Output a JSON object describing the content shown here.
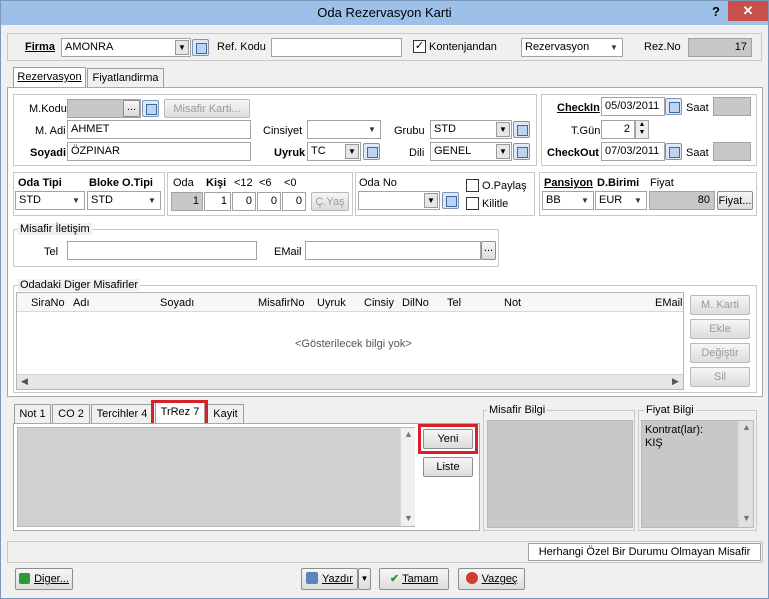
{
  "window": {
    "title": "Oda Rezervasyon Karti",
    "help": "?",
    "close": "✕"
  },
  "header": {
    "firma_label": "Firma",
    "firma_value": "AMONRA",
    "refkodu_label": "Ref. Kodu",
    "refkodu_value": "",
    "kontenjan_label": "Kontenjandan",
    "kontenjan_checked": "✓",
    "type_value": "Rezervasyon",
    "rezno_label": "Rez.No",
    "rezno_value": "17"
  },
  "tabs": [
    {
      "label": "Rezervasyon"
    },
    {
      "label": "Fiyatlandirma"
    }
  ],
  "guest": {
    "mkodu_label": "M.Kodu",
    "dots": "...",
    "misafir_karti": "Misafir Karti...",
    "madi_label": "M. Adi",
    "madi_value": "AHMET",
    "soyadi_label": "Soyadi",
    "soyadi_value": "ÖZPINAR",
    "cinsiyet_label": "Cinsiyet",
    "cinsiyet_value": "",
    "uyruk_label": "Uyruk",
    "uyruk_value": "TC",
    "grubu_label": "Grubu",
    "grubu_value": "STD",
    "dili_label": "Dili",
    "dili_value": "GENEL"
  },
  "dates": {
    "checkin_label": "CheckIn",
    "checkin_value": "05/03/2011",
    "saat_label": "Saat",
    "tgun_label": "T.Gün",
    "tgun_value": "2",
    "checkout_label": "CheckOut",
    "checkout_value": "07/03/2011"
  },
  "room": {
    "odatipi_label": "Oda Tipi",
    "odatipi_value": "STD",
    "bloke_label": "Bloke O.Tipi",
    "bloke_value": "STD",
    "oda_label": "Oda",
    "kisi_label": "Kişi",
    "lt12_label": "<12",
    "lt6_label": "<6",
    "lt0_label": "<0",
    "oda_value": "1",
    "kisi_value": "1",
    "lt12_value": "0",
    "lt6_value": "0",
    "lt0_value": "0",
    "cyas": "Ç.Yaş",
    "odano_label": "Oda No",
    "opaylas_label": "O.Paylaş",
    "kilitle_label": "Kilitle"
  },
  "pricing": {
    "pansiyon_label": "Pansiyon",
    "dbirimi_label": "D.Birimi",
    "fiyat_label": "Fiyat",
    "pansiyon_value": "BB",
    "dbirimi_value": "EUR",
    "fiyat_value": "80",
    "fiyat_button": "Fiyat..."
  },
  "contact": {
    "group_label": "Misafir İletişim",
    "tel_label": "Tel",
    "tel_value": "",
    "email_label": "EMail",
    "email_value": "",
    "dots": "..."
  },
  "others": {
    "group_label": "Odadaki Diger Misafirler",
    "columns": [
      "SiraNo",
      "Adı",
      "Soyadı",
      "MisafirNo",
      "Uyruk",
      "Cinsiy",
      "DilNo",
      "Tel",
      "Not",
      "EMail"
    ],
    "empty_text": "<Gösterilecek bilgi yok>",
    "buttons": {
      "mkarti": "M. Karti",
      "ekle": "Ekle",
      "degistir": "Değiştir",
      "sil": "Sil"
    }
  },
  "bottom_tabs": [
    {
      "label": "Not 1"
    },
    {
      "label": "CO 2"
    },
    {
      "label": "Tercihler 4"
    },
    {
      "label": "TrRez 7"
    },
    {
      "label": "Kayit"
    }
  ],
  "trrez": {
    "yeni": "Yeni",
    "liste": "Liste"
  },
  "misafir_bilgi": {
    "label": "Misafir Bilgi"
  },
  "fiyat_bilgi": {
    "label": "Fiyat Bilgi",
    "text": "Kontrat(lar):\nKIŞ"
  },
  "status": {
    "message": "Herhangi Özel Bir Durumu Olmayan Misafir"
  },
  "footer": {
    "diger": "Diger...",
    "yazdir": "Yazdır",
    "tamam": "Tamam",
    "vazgec": "Vazgeç"
  },
  "colors": {
    "highlight": "#d8202a",
    "titlebar": "#9cc0e8",
    "close": "#c7504a"
  }
}
